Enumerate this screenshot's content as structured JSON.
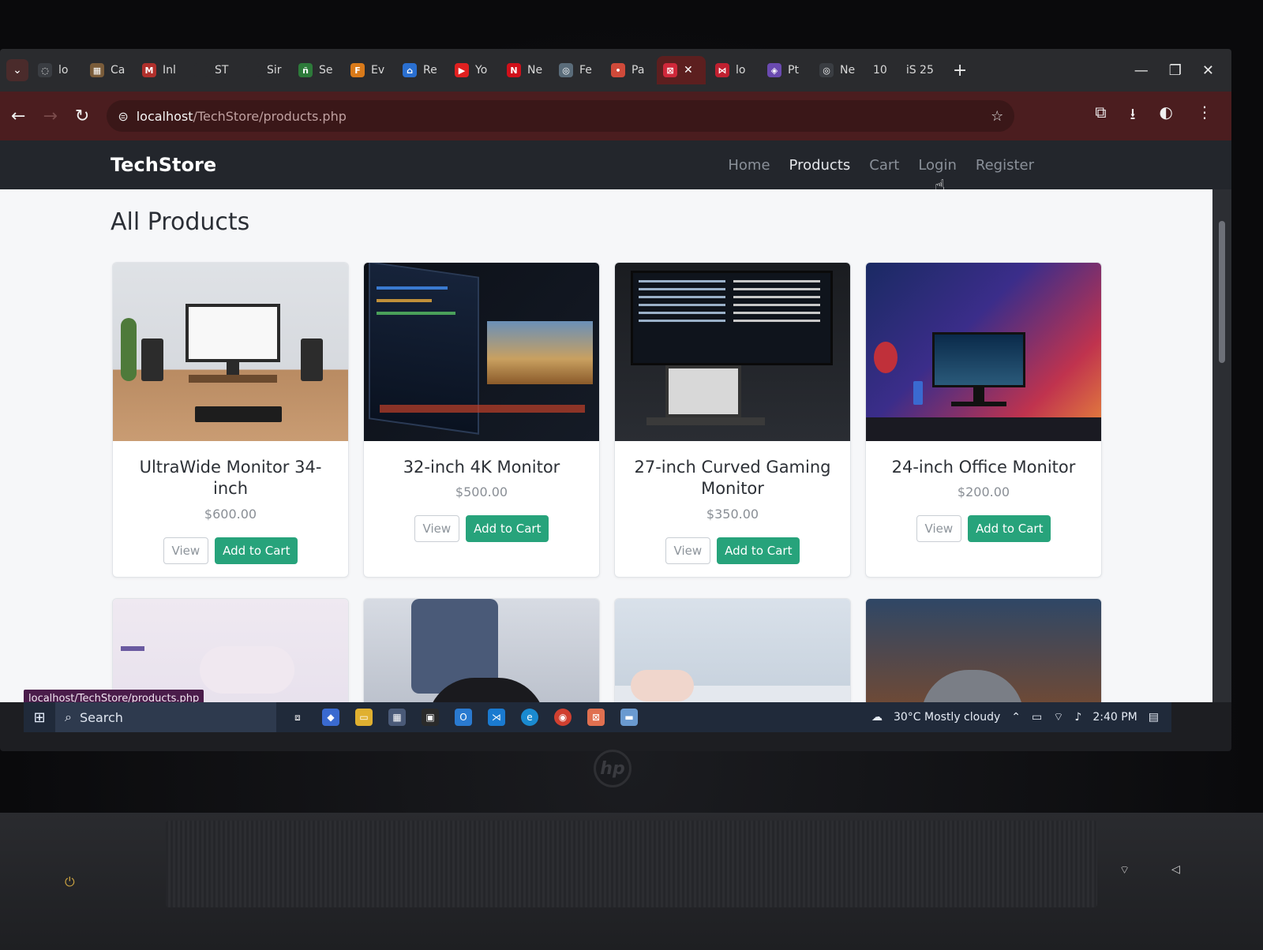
{
  "browser": {
    "tabs": [
      {
        "label": "lo",
        "fav_color": "#3a3d42",
        "fav": "◌"
      },
      {
        "label": "Ca",
        "fav_color": "#7a5c3a",
        "fav": "▦"
      },
      {
        "label": "Inl",
        "fav_color": "#b0302c",
        "fav": "M"
      },
      {
        "label": "ST",
        "fav_color": "#2a2b2e",
        "fav": ""
      },
      {
        "label": "Sir",
        "fav_color": "#2a2b2e",
        "fav": ""
      },
      {
        "label": "Se",
        "fav_color": "#2d7a3a",
        "fav": "ñ"
      },
      {
        "label": "Ev",
        "fav_color": "#d97a1a",
        "fav": "F"
      },
      {
        "label": "Re",
        "fav_color": "#2a6fd0",
        "fav": "⌂"
      },
      {
        "label": "Yo",
        "fav_color": "#e02020",
        "fav": "▶"
      },
      {
        "label": "Ne",
        "fav_color": "#d0101a",
        "fav": "N"
      },
      {
        "label": "Fe",
        "fav_color": "#5a6c7a",
        "fav": "◎"
      },
      {
        "label": "Pa",
        "fav_color": "#d04a3a",
        "fav": "•"
      }
    ],
    "active_tab": {
      "label": "",
      "fav_color": "#d0283a",
      "fav": "⊠"
    },
    "tabs_after": [
      {
        "label": "lo",
        "fav_color": "#c02030",
        "fav": "⋈"
      },
      {
        "label": "Pt",
        "fav_color": "#6a4ab0",
        "fav": "◈"
      },
      {
        "label": "Ne",
        "fav_color": "#3a3d42",
        "fav": "◎"
      }
    ],
    "tab_counter": "10",
    "tab_extra_label": "iS 25",
    "new_tab": "+",
    "minimize": "—",
    "restore": "❐",
    "close": "✕",
    "url_host": "localhost",
    "url_path": "/TechStore/products.php",
    "status_url": "localhost/TechStore/products.php"
  },
  "site": {
    "brand": "TechStore",
    "nav": [
      {
        "label": "Home",
        "active": false
      },
      {
        "label": "Products",
        "active": true
      },
      {
        "label": "Cart",
        "active": false
      },
      {
        "label": "Login",
        "active": false
      },
      {
        "label": "Register",
        "active": false
      }
    ],
    "page_title": "All Products",
    "view_label": "View",
    "cart_label": "Add to Cart",
    "products": [
      {
        "title": "UltraWide Monitor 34-inch",
        "price": "$600.00"
      },
      {
        "title": "32-inch 4K Monitor",
        "price": "$500.00"
      },
      {
        "title": "27-inch Curved Gaming Monitor",
        "price": "$350.00"
      },
      {
        "title": "24-inch Office Monitor",
        "price": "$200.00"
      }
    ]
  },
  "taskbar": {
    "search_label": "Search",
    "weather": "30°C  Mostly cloudy",
    "time": "2:40 PM"
  },
  "colors": {
    "accent_button": "#27a37b",
    "navbar_bg": "#23262c",
    "browser_toolbar": "#4b1d1f"
  },
  "laptop": {
    "logo": "hp"
  }
}
